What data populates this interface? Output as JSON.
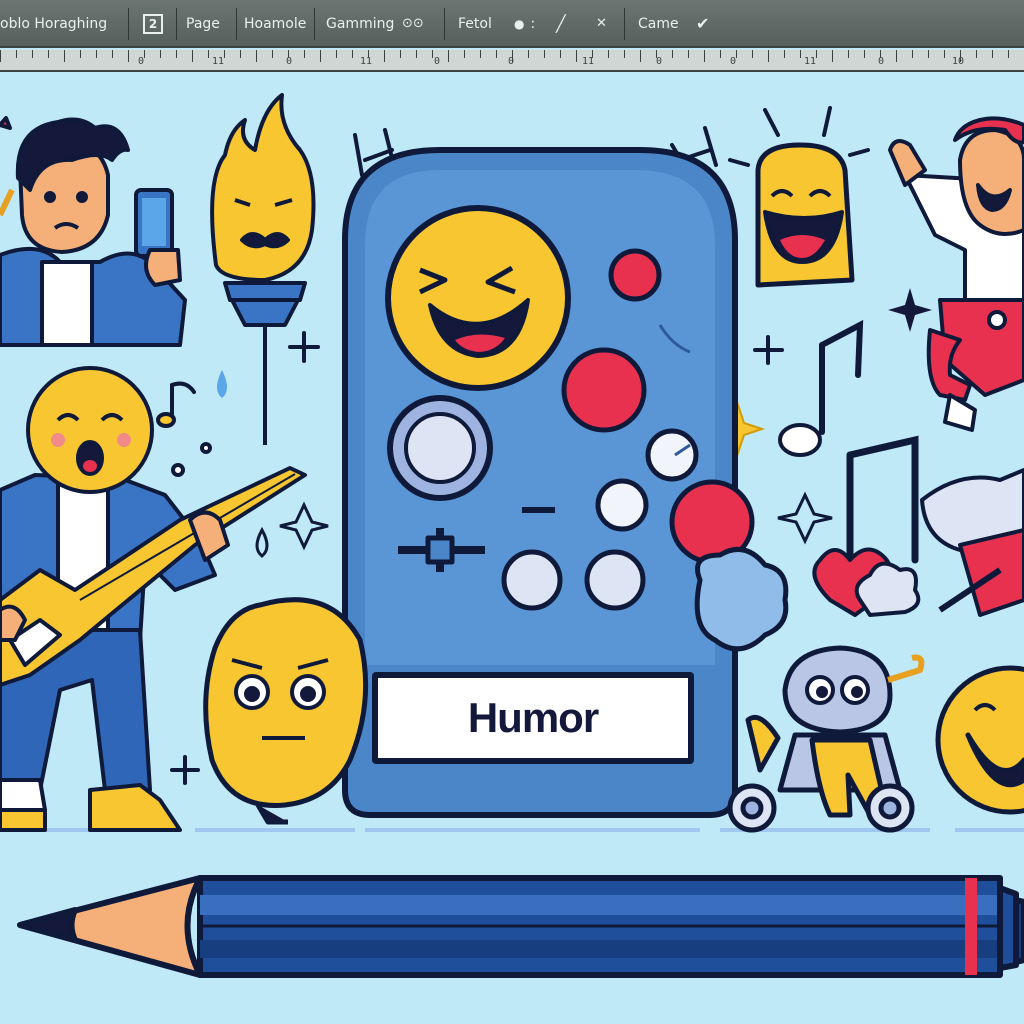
{
  "toolbar": {
    "items": [
      {
        "label": "oblo Horaghing",
        "icon": ""
      },
      {
        "label": "",
        "icon": "doc-icon",
        "glyph": "2"
      },
      {
        "label": "Page",
        "icon": ""
      },
      {
        "label": "Hoamole",
        "icon": ""
      },
      {
        "label": "Gamming",
        "icon": ""
      },
      {
        "label": "",
        "icon": "glasses-icon",
        "glyph": "⊙⊙"
      },
      {
        "label": "Fetol",
        "icon": ""
      },
      {
        "label": ":",
        "icon": "pin-icon",
        "glyph": "●"
      },
      {
        "label": "",
        "icon": "pencil-icon",
        "glyph": "╱"
      },
      {
        "label": "",
        "icon": "close-icon",
        "glyph": "✕"
      },
      {
        "label": "Came",
        "icon": ""
      },
      {
        "label": "",
        "icon": "check-icon",
        "glyph": "✔"
      }
    ]
  },
  "ruler": {
    "numbers": [
      "0",
      "11",
      "0",
      "11",
      "0",
      "0",
      "11",
      "0",
      "0",
      "11",
      "0",
      "10",
      "11"
    ]
  },
  "canvas": {
    "controller_label": "Humor"
  },
  "colors": {
    "background": "#bfe9f7",
    "toolbar": "#5f6966",
    "controller": "#4a86c8",
    "outline": "#0f1a3a",
    "emoji": "#f7c631",
    "button_red": "#e8304f",
    "pencil_blue": "#1f4f9a"
  }
}
